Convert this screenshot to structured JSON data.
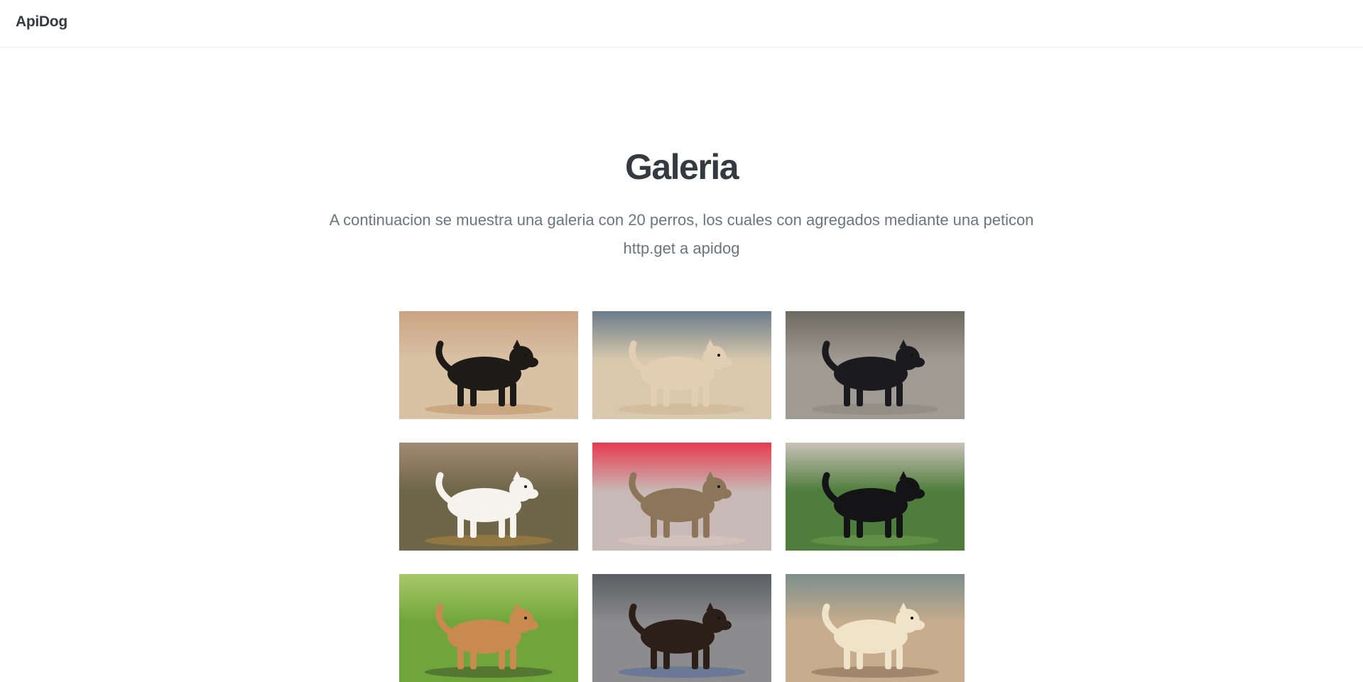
{
  "navbar": {
    "brand": "ApiDog"
  },
  "header": {
    "title": "Galeria",
    "lead": "A continuacion se muestra una galeria con 20 perros, los cuales con agregados mediante una peticon http.get a apidog"
  },
  "gallery": {
    "images": [
      {
        "icon": "dog-photo",
        "subject": "black and tan long-haired dog standing on rocky ground",
        "colors": {
          "bg": "#d9c1a4",
          "bg2": "#c9a383",
          "dog": "#1d1a18",
          "accent": "#b07840"
        }
      },
      {
        "icon": "dog-photo",
        "subject": "cream pit bull standing on dirt",
        "colors": {
          "bg": "#d8c9ad",
          "bg2": "#6b7c8a",
          "dog": "#e2cfb3",
          "accent": "#c9a986"
        }
      },
      {
        "icon": "dog-photo",
        "subject": "black curly dog on paved patio",
        "colors": {
          "bg": "#9f9a92",
          "bg2": "#6d6a60",
          "dog": "#1a1a1f",
          "accent": "#7d7a6e"
        }
      },
      {
        "icon": "dog-photo",
        "subject": "white fluffy dog standing in field",
        "colors": {
          "bg": "#6f6548",
          "bg2": "#a18b74",
          "dog": "#f6f3ee",
          "accent": "#d59a3a"
        }
      },
      {
        "icon": "dog-photo",
        "subject": "malamute lying on floor",
        "colors": {
          "bg": "#c7b9b5",
          "bg2": "#e93a4e",
          "dog": "#8d7559",
          "accent": "#e6d8c5"
        }
      },
      {
        "icon": "dog-photo",
        "subject": "black dog lying on green grass",
        "colors": {
          "bg": "#4e7d3c",
          "bg2": "#c9c2b8",
          "dog": "#141416",
          "accent": "#88b35a"
        }
      },
      {
        "icon": "dog-photo",
        "subject": "golden curly puppy lying on grass inside fence",
        "colors": {
          "bg": "#6fa53a",
          "bg2": "#a9c86a",
          "dog": "#c98a4f",
          "accent": "#222222"
        }
      },
      {
        "icon": "dog-photo",
        "subject": "doberman mix sitting in car",
        "colors": {
          "bg": "#8c8c8e",
          "bg2": "#5c5d62",
          "dog": "#2c1f18",
          "accent": "#2e56a6"
        }
      },
      {
        "icon": "dog-photo",
        "subject": "yellow labrador lying on sand",
        "colors": {
          "bg": "#c7ad8d",
          "bg2": "#7c8e8c",
          "dog": "#efe3c9",
          "accent": "#5b4634"
        }
      }
    ]
  }
}
